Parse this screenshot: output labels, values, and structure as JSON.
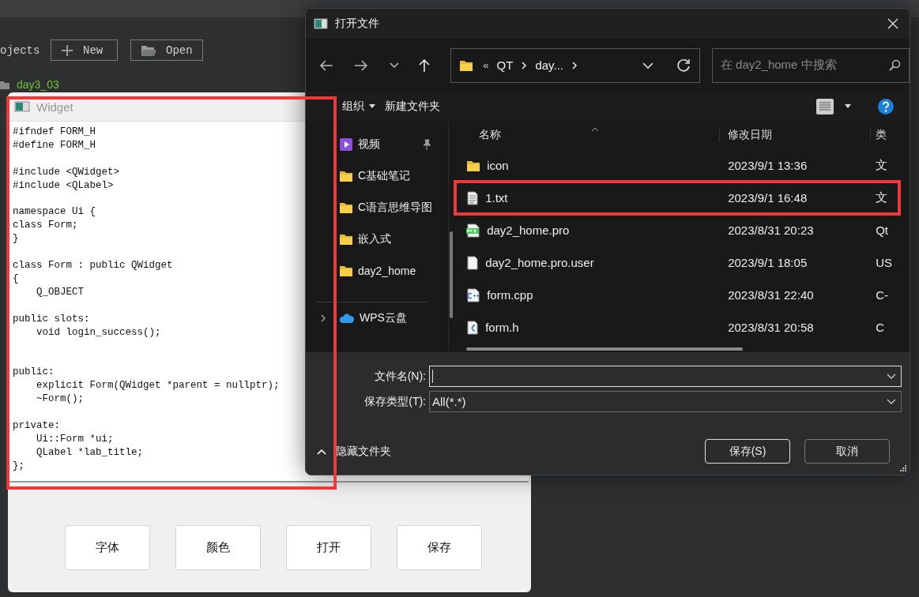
{
  "background_app": {
    "projects_label": "ojects",
    "new_button": "New",
    "open_button": "Open",
    "project": "day3_03"
  },
  "widget_window": {
    "title": "Widget",
    "editor": {
      "text": "#ifndef FORM_H\n#define FORM_H\n\n#include <QWidget>\n#include <QLabel>\n\nnamespace Ui {\nclass Form;\n}\n\nclass Form : public QWidget\n{\n    Q_OBJECT\n\npublic slots:\n    void login_success();\n\n\npublic:\n    explicit Form(QWidget *parent = nullptr);\n    ~Form();\n\nprivate:\n    Ui::Form *ui;\n    QLabel *lab_title;\n};",
      "highlighted": true
    },
    "buttons": [
      "字体",
      "颜色",
      "打开",
      "保存"
    ]
  },
  "file_dialog": {
    "title": "打开文件",
    "overflow": "«",
    "breadcrumb": [
      "QT",
      "day..."
    ],
    "search": {
      "placeholder": "在 day2_home 中搜索"
    },
    "toolbar": {
      "organize": "组织",
      "new_folder": "新建文件夹"
    },
    "sidebar": [
      {
        "label": "视频",
        "kind": "video",
        "pinned": true
      },
      {
        "label": "C基础笔记",
        "kind": "folder",
        "pinned": false
      },
      {
        "label": "C语言思维导图",
        "kind": "folder",
        "pinned": false
      },
      {
        "label": "嵌入式",
        "kind": "folder",
        "pinned": false
      },
      {
        "label": "day2_home",
        "kind": "folder",
        "pinned": false
      },
      {
        "label": "WPS云盘",
        "kind": "cloud",
        "pinned": false
      }
    ],
    "columns": [
      "名称",
      "修改日期",
      "类"
    ],
    "files": [
      {
        "name": "icon",
        "modified": "2023/9/1 13:36",
        "type": "文",
        "kind": "folder",
        "highlighted": false
      },
      {
        "name": "1.txt",
        "modified": "2023/9/1 16:48",
        "type": "文",
        "kind": "text",
        "highlighted": true
      },
      {
        "name": "day2_home.pro",
        "modified": "2023/8/31 20:23",
        "type": "Qt",
        "kind": "pro",
        "highlighted": false
      },
      {
        "name": "day2_home.pro.user",
        "modified": "2023/9/1 18:05",
        "type": "US",
        "kind": "blank",
        "highlighted": false
      },
      {
        "name": "form.cpp",
        "modified": "2023/8/31 22:40",
        "type": "C-",
        "kind": "cpp",
        "highlighted": false
      },
      {
        "name": "form.h",
        "modified": "2023/8/31 20:58",
        "type": "C",
        "kind": "h",
        "highlighted": false
      }
    ],
    "filename_label": "文件名(N):",
    "filetype_label": "保存类型(T):",
    "filetype_value": "All(*.*)",
    "hide_folders": "隐藏文件夹",
    "save_button": "保存(S)",
    "cancel_button": "取消"
  }
}
